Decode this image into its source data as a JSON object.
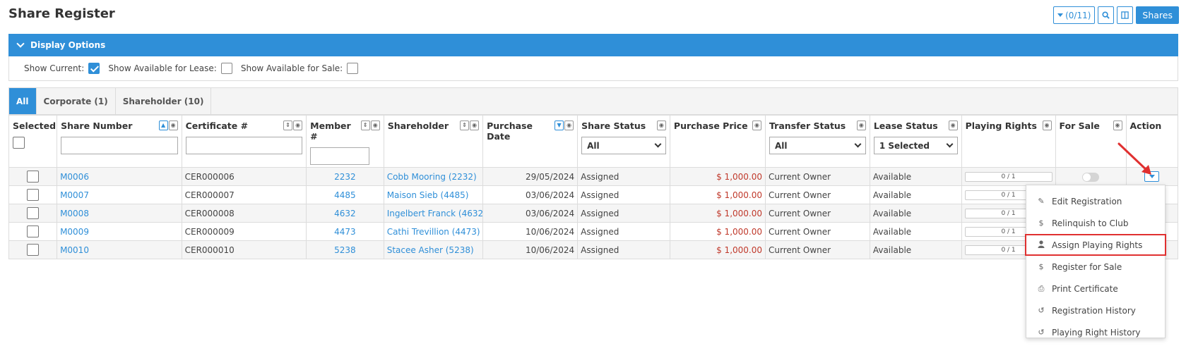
{
  "page": {
    "title": "Share Register"
  },
  "toolbar": {
    "filter_label": "(0/11)",
    "search_icon": "search-icon",
    "columns_icon": "columns-icon",
    "shares_label": "Shares"
  },
  "display_options": {
    "title": "Display Options",
    "show_current_label": "Show Current:",
    "show_current_checked": true,
    "lease_label": "Show Available for Lease:",
    "lease_checked": false,
    "sale_label": "Show Available for Sale:",
    "sale_checked": false
  },
  "tabs": [
    {
      "label": "All",
      "active": true
    },
    {
      "label": "Corporate (1)",
      "active": false
    },
    {
      "label": "Shareholder (10)",
      "active": false
    }
  ],
  "columns": {
    "selected": "Selected",
    "share_number": "Share Number",
    "certificate": "Certificate #",
    "member": "Member #",
    "shareholder": "Shareholder",
    "purchase_date": "Purchase Date",
    "share_status": "Share Status",
    "purchase_price": "Purchase Price",
    "transfer_status": "Transfer Status",
    "lease_status": "Lease Status",
    "playing_rights": "Playing Rights",
    "for_sale": "For Sale",
    "action": "Action"
  },
  "filters": {
    "share_status": "All",
    "transfer_status": "All",
    "lease_status": "1 Selected"
  },
  "rows": [
    {
      "share": "M0006",
      "cert": "CER000006",
      "member": "2232",
      "shareholder": "Cobb Mooring (2232)",
      "date": "29/05/2024",
      "status": "Assigned",
      "price": "$ 1,000.00",
      "transfer": "Current Owner",
      "lease": "Available",
      "rights": "0 / 1"
    },
    {
      "share": "M0007",
      "cert": "CER000007",
      "member": "4485",
      "shareholder": "Maison Sieb (4485)",
      "date": "03/06/2024",
      "status": "Assigned",
      "price": "$ 1,000.00",
      "transfer": "Current Owner",
      "lease": "Available",
      "rights": "0 / 1"
    },
    {
      "share": "M0008",
      "cert": "CER000008",
      "member": "4632",
      "shareholder": "Ingelbert Franck (4632)",
      "date": "03/06/2024",
      "status": "Assigned",
      "price": "$ 1,000.00",
      "transfer": "Current Owner",
      "lease": "Available",
      "rights": "0 / 1"
    },
    {
      "share": "M0009",
      "cert": "CER000009",
      "member": "4473",
      "shareholder": "Cathi Trevillion (4473)",
      "date": "10/06/2024",
      "status": "Assigned",
      "price": "$ 1,000.00",
      "transfer": "Current Owner",
      "lease": "Available",
      "rights": "0 / 1"
    },
    {
      "share": "M0010",
      "cert": "CER000010",
      "member": "5238",
      "shareholder": "Stacee Asher (5238)",
      "date": "10/06/2024",
      "status": "Assigned",
      "price": "$ 1,000.00",
      "transfer": "Current Owner",
      "lease": "Available",
      "rights": "0 / 1"
    }
  ],
  "action_menu": [
    {
      "label": "Edit Registration",
      "icon": "pencil-icon"
    },
    {
      "label": "Relinquish to Club",
      "icon": "dollar-icon"
    },
    {
      "label": "Assign Playing Rights",
      "icon": "user-icon",
      "highlighted": true
    },
    {
      "label": "Register for Sale",
      "icon": "dollar-icon"
    },
    {
      "label": "Print Certificate",
      "icon": "printer-icon"
    },
    {
      "label": "Registration History",
      "icon": "history-icon"
    },
    {
      "label": "Playing Right History",
      "icon": "history-icon"
    }
  ],
  "colors": {
    "accent": "#2f8fd8",
    "price": "#c0392b",
    "highlight": "#e03030"
  }
}
